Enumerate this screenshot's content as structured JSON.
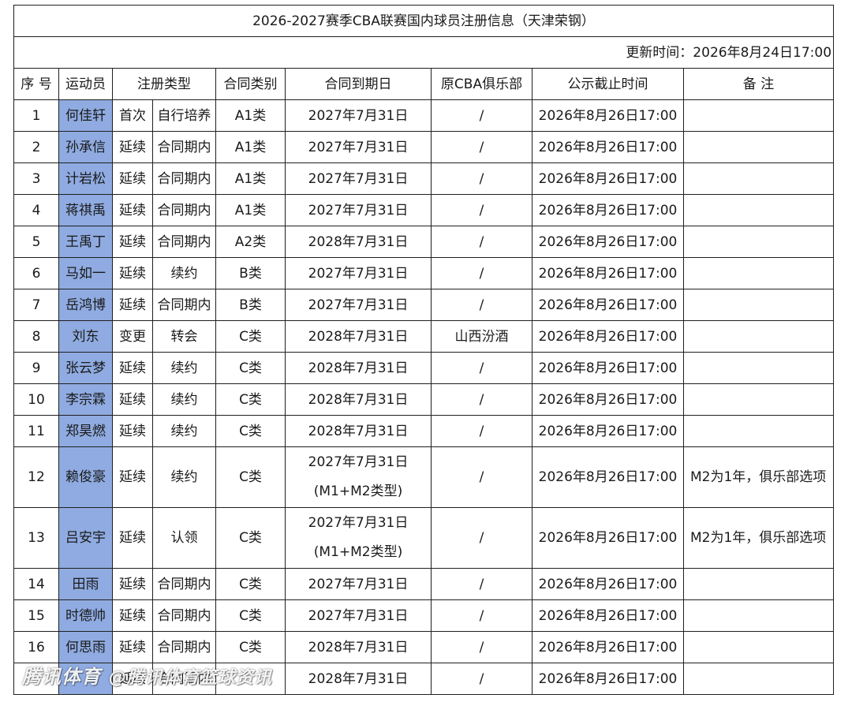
{
  "title": "2026-2027赛季CBA联赛国内球员注册信息（天津荣钢）",
  "updated": "更新时间：2026年8月24日17:00",
  "headers": {
    "no": "序 号",
    "player": "运动员",
    "reg_type": "注册类型",
    "contract_class": "合同类别",
    "expiry": "合同到期日",
    "prev_club": "原CBA俱乐部",
    "deadline": "公示截止时间",
    "remark": "备 注"
  },
  "rows": [
    {
      "no": "1",
      "player": "何佳轩",
      "reg1": "首次",
      "reg2": "自行培养",
      "class": "A1类",
      "expiry": "2027年7月31日",
      "expiry2": "",
      "prev": "/",
      "deadline": "2026年8月26日17:00",
      "remark": ""
    },
    {
      "no": "2",
      "player": "孙承信",
      "reg1": "延续",
      "reg2": "合同期内",
      "class": "A1类",
      "expiry": "2027年7月31日",
      "expiry2": "",
      "prev": "/",
      "deadline": "2026年8月26日17:00",
      "remark": ""
    },
    {
      "no": "3",
      "player": "计岩松",
      "reg1": "延续",
      "reg2": "合同期内",
      "class": "A1类",
      "expiry": "2027年7月31日",
      "expiry2": "",
      "prev": "/",
      "deadline": "2026年8月26日17:00",
      "remark": ""
    },
    {
      "no": "4",
      "player": "蒋祺禹",
      "reg1": "延续",
      "reg2": "合同期内",
      "class": "A1类",
      "expiry": "2027年7月31日",
      "expiry2": "",
      "prev": "/",
      "deadline": "2026年8月26日17:00",
      "remark": ""
    },
    {
      "no": "5",
      "player": "王禹丁",
      "reg1": "延续",
      "reg2": "合同期内",
      "class": "A2类",
      "expiry": "2028年7月31日",
      "expiry2": "",
      "prev": "/",
      "deadline": "2026年8月26日17:00",
      "remark": ""
    },
    {
      "no": "6",
      "player": "马如一",
      "reg1": "延续",
      "reg2": "续约",
      "class": "B类",
      "expiry": "2027年7月31日",
      "expiry2": "",
      "prev": "/",
      "deadline": "2026年8月26日17:00",
      "remark": ""
    },
    {
      "no": "7",
      "player": "岳鸿博",
      "reg1": "延续",
      "reg2": "合同期内",
      "class": "B类",
      "expiry": "2027年7月31日",
      "expiry2": "",
      "prev": "/",
      "deadline": "2026年8月26日17:00",
      "remark": ""
    },
    {
      "no": "8",
      "player": "刘东",
      "reg1": "变更",
      "reg2": "转会",
      "class": "C类",
      "expiry": "2028年7月31日",
      "expiry2": "",
      "prev": "山西汾酒",
      "deadline": "2026年8月26日17:00",
      "remark": ""
    },
    {
      "no": "9",
      "player": "张云梦",
      "reg1": "延续",
      "reg2": "续约",
      "class": "C类",
      "expiry": "2028年7月31日",
      "expiry2": "",
      "prev": "/",
      "deadline": "2026年8月26日17:00",
      "remark": ""
    },
    {
      "no": "10",
      "player": "李宗霖",
      "reg1": "延续",
      "reg2": "续约",
      "class": "C类",
      "expiry": "2028年7月31日",
      "expiry2": "",
      "prev": "/",
      "deadline": "2026年8月26日17:00",
      "remark": ""
    },
    {
      "no": "11",
      "player": "郑昊燃",
      "reg1": "延续",
      "reg2": "续约",
      "class": "C类",
      "expiry": "2028年7月31日",
      "expiry2": "",
      "prev": "/",
      "deadline": "2026年8月26日17:00",
      "remark": ""
    },
    {
      "no": "12",
      "player": "赖俊豪",
      "reg1": "延续",
      "reg2": "续约",
      "class": "C类",
      "expiry": "2027年7月31日",
      "expiry2": "(M1+M2类型)",
      "prev": "/",
      "deadline": "2026年8月26日17:00",
      "remark": "M2为1年，俱乐部选项"
    },
    {
      "no": "13",
      "player": "吕安宇",
      "reg1": "延续",
      "reg2": "认领",
      "class": "C类",
      "expiry": "2027年7月31日",
      "expiry2": "(M1+M2类型)",
      "prev": "/",
      "deadline": "2026年8月26日17:00",
      "remark": "M2为1年，俱乐部选项"
    },
    {
      "no": "14",
      "player": "田雨",
      "reg1": "延续",
      "reg2": "合同期内",
      "class": "C类",
      "expiry": "2027年7月31日",
      "expiry2": "",
      "prev": "/",
      "deadline": "2026年8月26日17:00",
      "remark": ""
    },
    {
      "no": "15",
      "player": "时德帅",
      "reg1": "延续",
      "reg2": "合同期内",
      "class": "C类",
      "expiry": "2027年7月31日",
      "expiry2": "",
      "prev": "/",
      "deadline": "2026年8月26日17:00",
      "remark": ""
    },
    {
      "no": "16",
      "player": "何思雨",
      "reg1": "延续",
      "reg2": "合同期内",
      "class": "C类",
      "expiry": "2028年7月31日",
      "expiry2": "",
      "prev": "/",
      "deadline": "2026年8月26日17:00",
      "remark": ""
    },
    {
      "no": "",
      "player": "",
      "reg1": "延续",
      "reg2": "合同期内",
      "class": "",
      "expiry": "2028年7月31日",
      "expiry2": "",
      "prev": "/",
      "deadline": "2026年8月26日17:00",
      "remark": ""
    }
  ],
  "watermark": {
    "brand": "腾讯体育",
    "handle": "@腾讯体育篮球资讯"
  }
}
